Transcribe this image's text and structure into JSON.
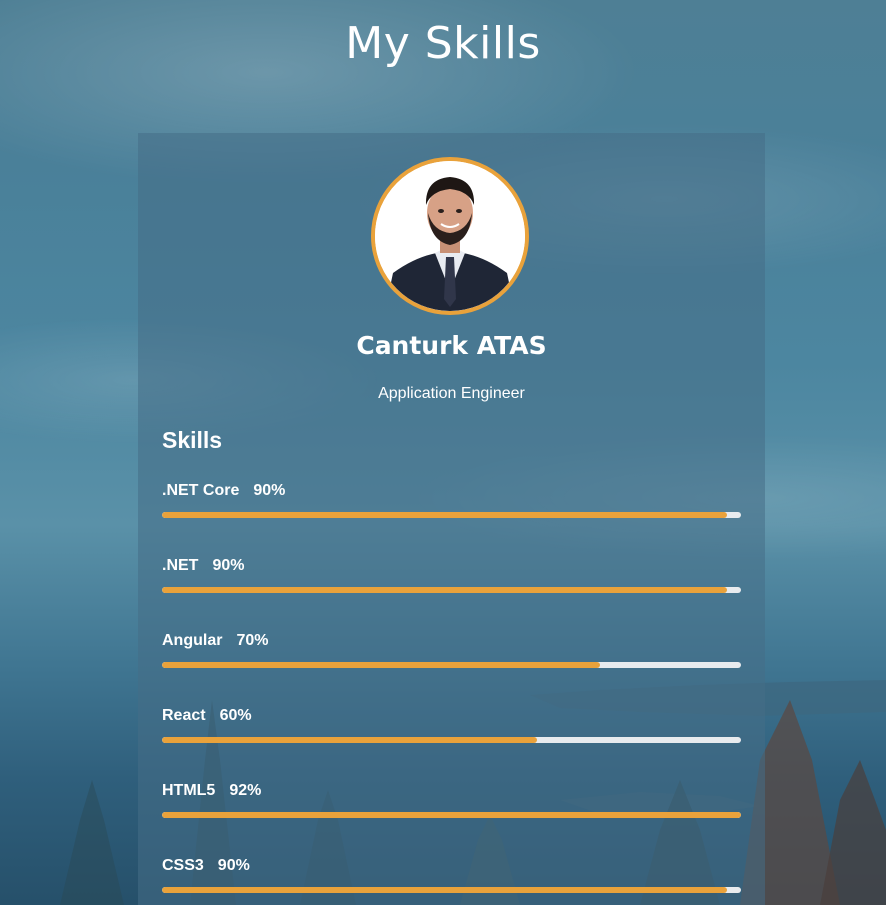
{
  "page": {
    "title": "My Skills"
  },
  "profile": {
    "name": "Canturk ATAS",
    "role": "Application Engineer"
  },
  "skills": {
    "heading": "Skills",
    "items": [
      {
        "name": ".NET Core",
        "percent_label": "90%",
        "level": 0.975
      },
      {
        "name": ".NET",
        "percent_label": "90%",
        "level": 0.975
      },
      {
        "name": "Angular",
        "percent_label": "70%",
        "level": 0.757
      },
      {
        "name": "React",
        "percent_label": "60%",
        "level": 0.648
      },
      {
        "name": "HTML5",
        "percent_label": "92%",
        "level": 1.0
      },
      {
        "name": "CSS3",
        "percent_label": "90%",
        "level": 0.975
      }
    ]
  },
  "colors": {
    "accent": "#e9a23b",
    "track": "#e8ebee",
    "text": "#ffffff"
  }
}
